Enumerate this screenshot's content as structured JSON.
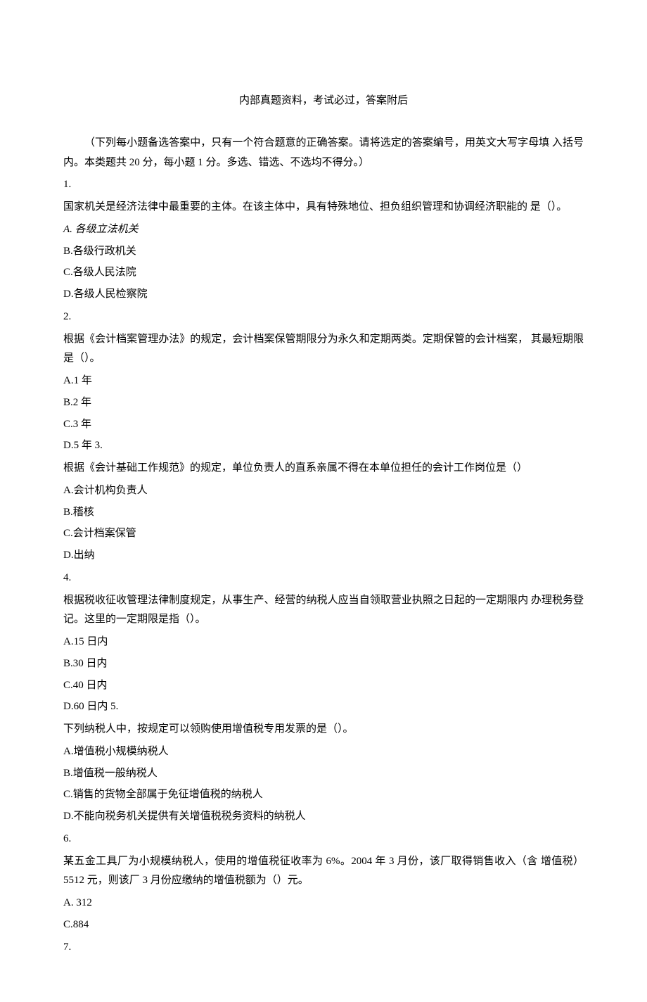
{
  "header": "内部真题资料，考试必过，答案附后",
  "instructions": "（下列每小题备选答案中，只有一个符合题意的正确答案。请将选定的答案编号，用英文大写字母填 入括号内。本类题共 20 分，每小题 1 分。多选、错选、不选均不得分。）",
  "q1": {
    "num": "1.",
    "text": "国家机关是经济法律中最重要的主体。在该主体中，具有特殊地位、担负组织管理和协调经济职能的 是（）。",
    "a": "A. 各级立法机关",
    "b": "B.各级行政机关",
    "c": "C.各级人民法院",
    "d": "D.各级人民检察院"
  },
  "q2": {
    "num": "2.",
    "text": "根据《会计档案管理办法》的规定，会计档案保管期限分为永久和定期两类。定期保管的会计档案， 其最短期限是（）。",
    "a": "A.1 年",
    "b": "B.2 年",
    "c": "C.3 年",
    "d": "D.5 年  3."
  },
  "q3": {
    "text": "根据《会计基础工作规范》的规定，单位负责人的直系亲属不得在本单位担任的会计工作岗位是（）",
    "a": "A.会计机构负责人",
    "b": "B.稽核",
    "c": "C.会计档案保管",
    "d": "D.出纳"
  },
  "q4": {
    "num": "4.",
    "text": "根据税收征收管理法律制度规定，从事生产、经营的纳税人应当自领取营业执照之日起的一定期限内 办理税务登记。这里的一定期限是指（）。",
    "a": "A.15 日内",
    "b": "B.30 日内",
    "c": "C.40 日内",
    "d": "D.60 日内  5."
  },
  "q5": {
    "text": "下列纳税人中，按规定可以领购使用增值税专用发票的是（）。",
    "a": "A.增值税小规模纳税人",
    "b": "B.增值税一般纳税人",
    "c": "C.销售的货物全部属于免征增值税的纳税人",
    "d": "D.不能向税务机关提供有关增值税税务资料的纳税人"
  },
  "q6": {
    "num": "6.",
    "text": "某五金工具厂为小规模纳税人，使用的增值税征收率为 6%。2004 年 3 月份，该厂取得销售收入（含 增值税）5512 元，则该厂 3 月份应缴纳的增值税额为（）元。",
    "a": "A. 312",
    "c": "C.884"
  },
  "q7": {
    "num": "7."
  }
}
